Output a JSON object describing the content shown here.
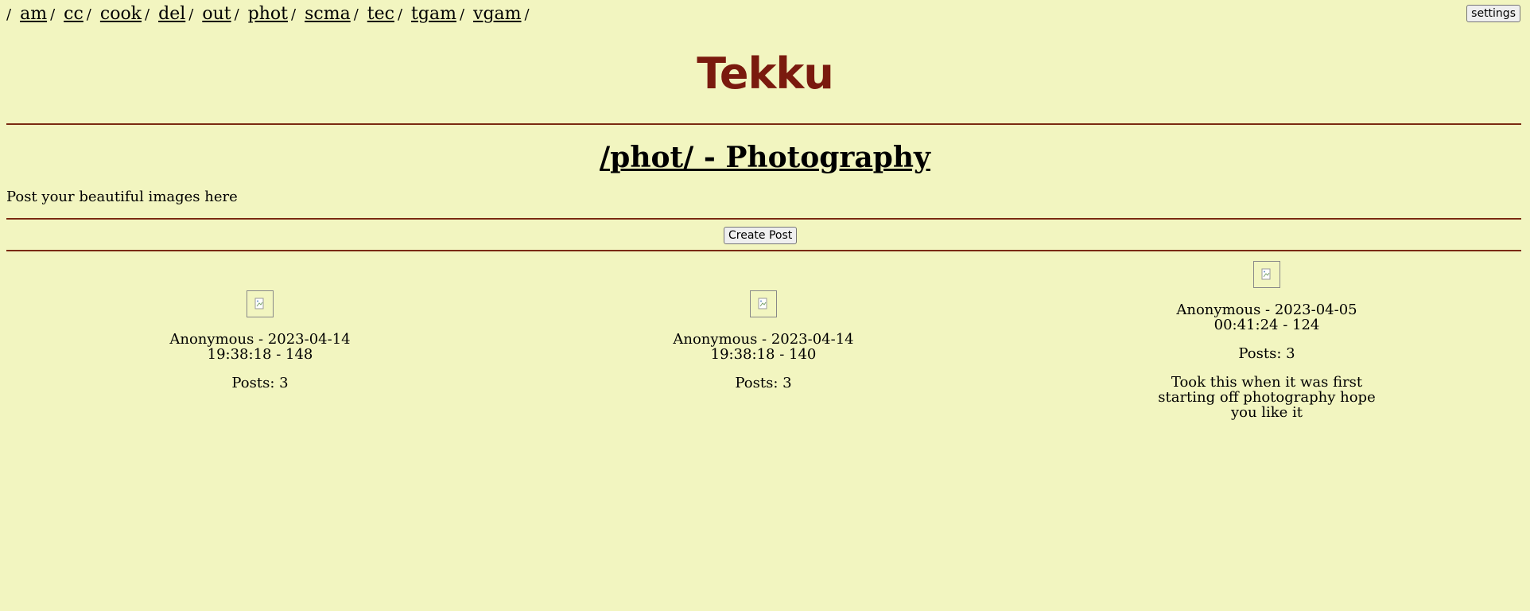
{
  "nav": {
    "boards": [
      "am",
      "cc",
      "cook",
      "del",
      "out",
      "phot",
      "scma",
      "tec",
      "tgam",
      "vgam"
    ],
    "separator": "/"
  },
  "settings_label": "settings",
  "site_title": "Tekku",
  "board": {
    "title": "/phot/ - Photography",
    "description": "Post your beautiful images here"
  },
  "create_post_label": "Create Post",
  "threads": [
    {
      "meta_line1": "Anonymous - 2023-04-14",
      "meta_line2": "19:38:18 - 148",
      "posts": "Posts: 3",
      "text": ""
    },
    {
      "meta_line1": "Anonymous - 2023-04-14",
      "meta_line2": "19:38:18 - 140",
      "posts": "Posts: 3",
      "text": ""
    },
    {
      "meta_line1": "Anonymous - 2023-04-05",
      "meta_line2": "00:41:24 - 124",
      "posts": "Posts: 3",
      "text_lines": [
        "Took this when it was first",
        "starting off photography hope",
        "you like it"
      ]
    }
  ],
  "colors": {
    "background": "#f2f5c0",
    "brand": "#7a1a0e",
    "rule": "#7a2a12"
  }
}
